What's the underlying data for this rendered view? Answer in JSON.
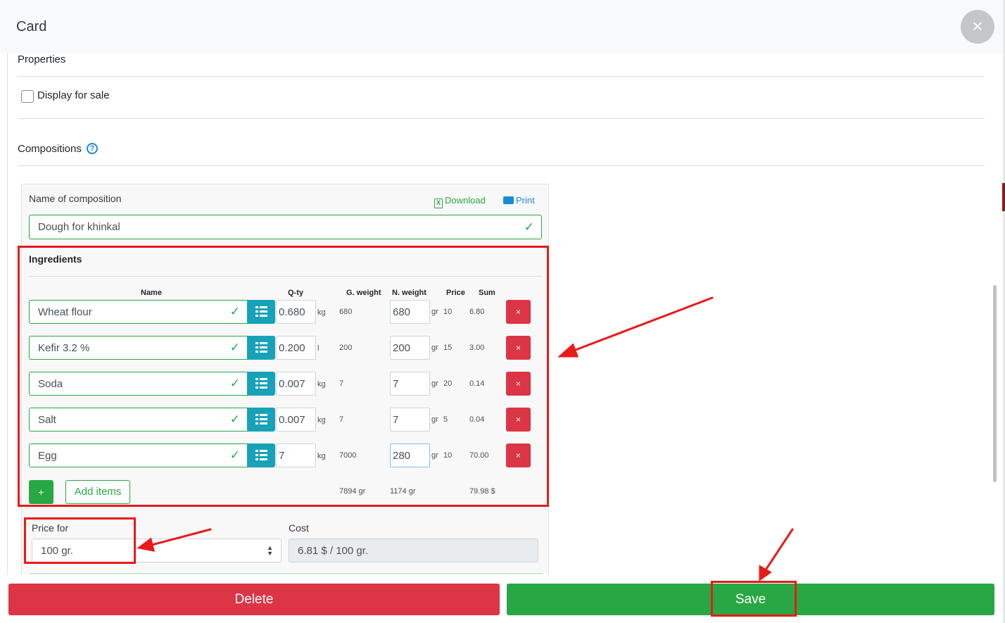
{
  "dialog": {
    "title": "Card",
    "close_glyph": "×"
  },
  "properties": {
    "heading": "Properties",
    "display_for_sale_label": "Display for sale"
  },
  "compositions": {
    "heading": "Compositions",
    "help_glyph": "?",
    "name_label": "Name of composition",
    "download_label": "Download",
    "print_label": "Print",
    "name_value": "Dough for khinkal",
    "ingredients_heading": "Ingredients",
    "columns": {
      "name": "Name",
      "qty": "Q-ty",
      "g_weight": "G. weight",
      "n_weight": "N. weight",
      "price": "Price",
      "sum": "Sum"
    },
    "rows": [
      {
        "name": "Wheat flour",
        "qty": "0.680",
        "unit": "kg",
        "g_weight": "680",
        "n_weight": "680",
        "n_unit": "gr",
        "price": "10",
        "sum": "6.80"
      },
      {
        "name": "Kefir 3.2 %",
        "qty": "0.200",
        "unit": "l",
        "g_weight": "200",
        "n_weight": "200",
        "n_unit": "gr",
        "price": "15",
        "sum": "3.00"
      },
      {
        "name": "Soda",
        "qty": "0.007",
        "unit": "kg",
        "g_weight": "7",
        "n_weight": "7",
        "n_unit": "gr",
        "price": "20",
        "sum": "0.14"
      },
      {
        "name": "Salt",
        "qty": "0.007",
        "unit": "kg",
        "g_weight": "7",
        "n_weight": "7",
        "n_unit": "gr",
        "price": "5",
        "sum": "0.04"
      },
      {
        "name": "Egg",
        "qty": "7",
        "unit": "kg",
        "g_weight": "7000",
        "n_weight": "280",
        "n_unit": "gr",
        "price": "10",
        "sum": "70.00"
      }
    ],
    "delete_glyph": "×",
    "plus_glyph": "+",
    "add_items_label": "Add items",
    "totals": {
      "g_weight": "7894 gr",
      "n_weight": "1174 gr",
      "sum": "79.98 $"
    },
    "price_for_label": "Price for",
    "price_for_value": "100 gr.",
    "cost_label": "Cost",
    "cost_value": "6.81 $ / 100 gr."
  },
  "footer": {
    "delete_label": "Delete",
    "save_label": "Save"
  },
  "colors": {
    "danger": "#dc3545",
    "success": "#28a745",
    "info": "#17a2b8",
    "annotation": "#e81a1a"
  }
}
